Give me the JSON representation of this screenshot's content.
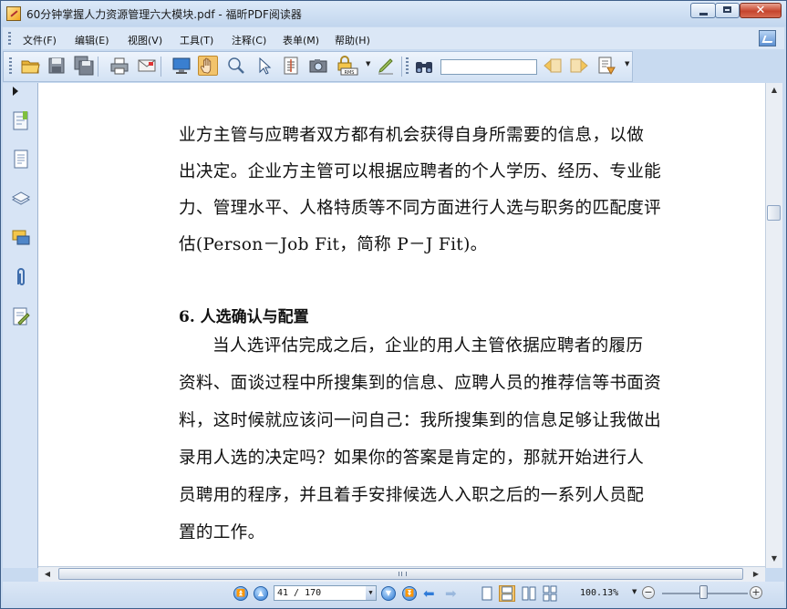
{
  "window": {
    "title": "60分钟掌握人力资源管理六大模块.pdf - 福昕PDF阅读器",
    "close_label": "✕"
  },
  "menu": {
    "items": [
      {
        "label": "文件(F)"
      },
      {
        "label": "编辑(E)"
      },
      {
        "label": "视图(V)"
      },
      {
        "label": "工具(T)"
      },
      {
        "label": "注释(C)"
      },
      {
        "label": "表单(M)"
      },
      {
        "label": "帮助(H)"
      }
    ]
  },
  "toolbar": {
    "search_value": "",
    "rms_label": "RMS"
  },
  "document": {
    "paragraph1": [
      "业方主管与应聘者双方都有机会获得自身所需要的信息，以做",
      "出决定。企业方主管可以根据应聘者的个人学历、经历、专业能",
      "力、管理水平、人格特质等不同方面进行人选与职务的匹配度评",
      "估(Person－Job Fit，简称 P－J Fit)。"
    ],
    "heading": "6. 人选确认与配置",
    "paragraph2": [
      "当人选评估完成之后，企业的用人主管依据应聘者的履历",
      "资料、面谈过程中所搜集到的信息、应聘人员的推荐信等书面资",
      "料，这时候就应该问一问自己：我所搜集到的信息足够让我做出",
      "录用人选的决定吗？如果你的答案是肯定的，那就开始进行人",
      "员聘用的程序，并且着手安排候选人入职之后的一系列人员配",
      "置的工作。"
    ]
  },
  "navigation": {
    "current_page": "41",
    "total_pages": "170",
    "page_display": "41 / 170",
    "zoom": "100.13%",
    "zoom_fraction": 0.45
  },
  "colors": {
    "chrome": "#c8daf0",
    "accent_blue": "#2c78d2",
    "hand_tool_active": "#f2c36b"
  }
}
